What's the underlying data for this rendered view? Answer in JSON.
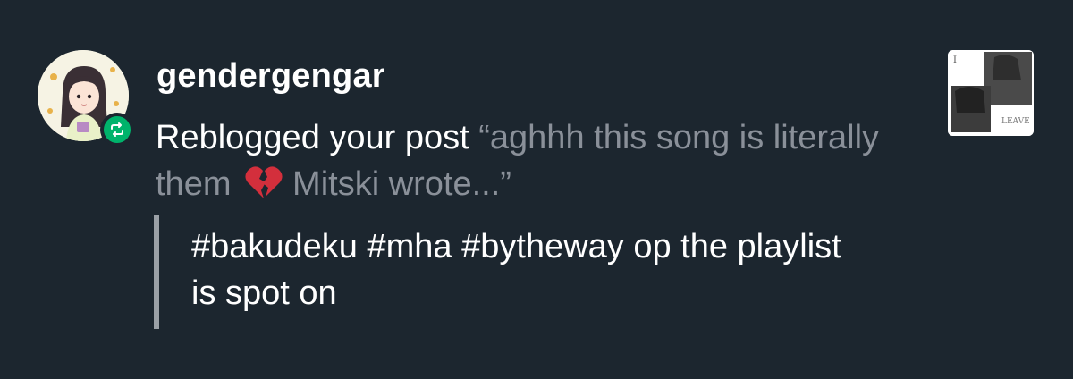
{
  "notification": {
    "username": "gendergengar",
    "action_text": "Reblogged your post ",
    "post_excerpt_part1": "“aghhh this song is literally them",
    "post_excerpt_part2": "Mitski wrote...”",
    "tags_text": "#bakudeku #mha #bytheway op the playlist is spot on",
    "thumbnail_text": "LEAVE"
  },
  "icons": {
    "avatar": "avatar-image",
    "badge": "reblog-icon",
    "emoji": "broken-heart-icon",
    "thumbnail": "post-thumbnail"
  },
  "colors": {
    "background": "#1c262f",
    "reblog_green": "#00b36b",
    "excerpt_gray": "#8a9099",
    "tag_bar": "#9aa0a6",
    "broken_heart": "#d32f3c"
  }
}
